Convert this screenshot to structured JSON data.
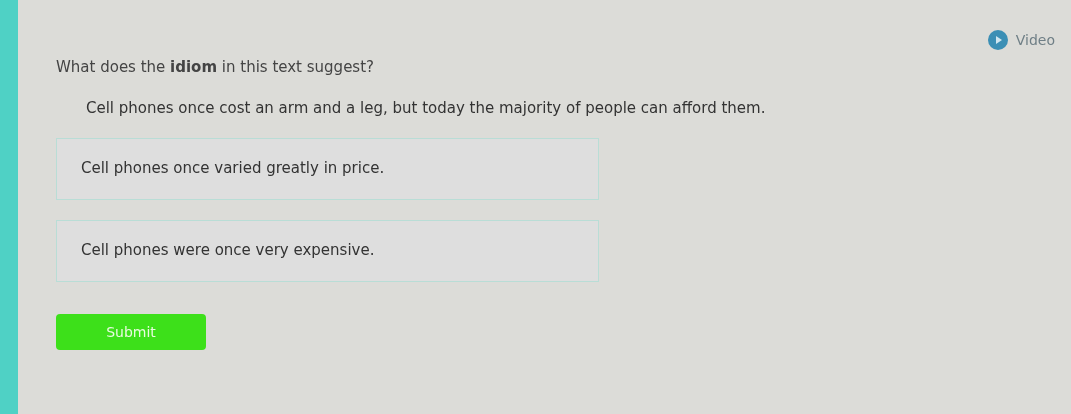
{
  "video_link": {
    "label": "Video"
  },
  "question": "What does the **idiom** in this text suggest?",
  "passage": "Cell phones once cost an arm and a leg, but today the majority of people can afford them.",
  "choices": [
    {
      "label": "Cell phones once varied greatly in price.",
      "selected": false
    },
    {
      "label": "Cell phones were once very expensive.",
      "selected": false
    }
  ],
  "submit": {
    "label": "Submit"
  }
}
